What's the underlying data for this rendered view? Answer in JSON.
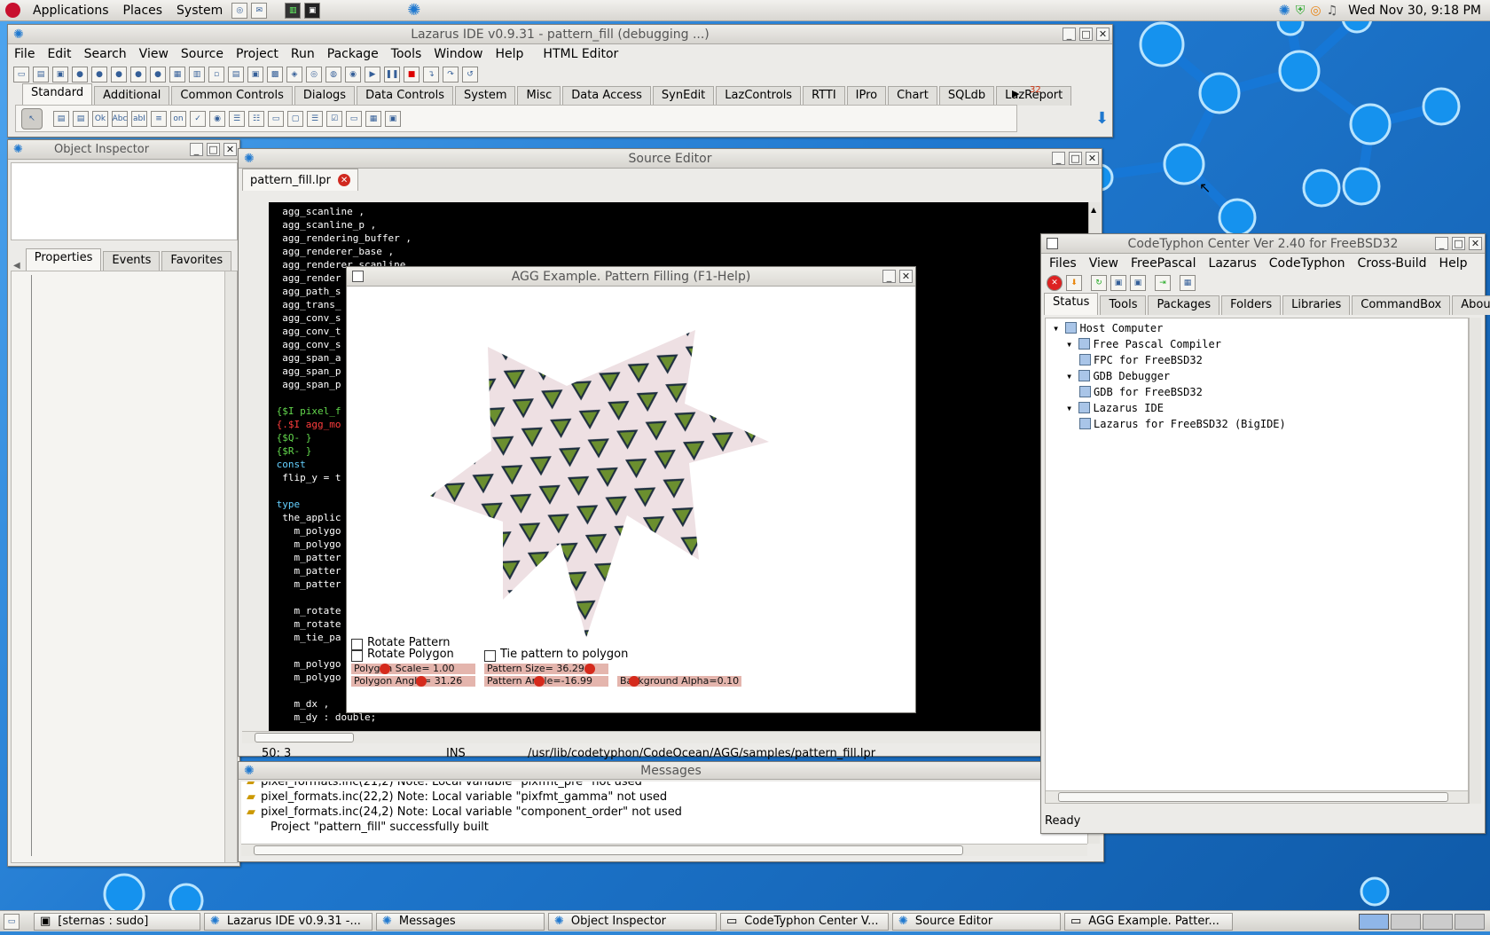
{
  "colors": {
    "accent": "#1e7ad0",
    "code_bg": "#000000",
    "code_text": "#ffffff",
    "red": "#d52a1c",
    "pattern_green": "#6b8f2f"
  },
  "panel": {
    "menu": [
      "Applications",
      "Places",
      "System"
    ],
    "clock": "Wed Nov 30,  9:18 PM"
  },
  "lazarus": {
    "title": "Lazarus IDE v0.9.31 - pattern_fill (debugging ...)",
    "menu": [
      "File",
      "Edit",
      "Search",
      "View",
      "Source",
      "Project",
      "Run",
      "Package",
      "Tools",
      "Window",
      "Help",
      "HTML Editor"
    ],
    "palette_tabs": [
      "Standard",
      "Additional",
      "Common Controls",
      "Dialogs",
      "Data Controls",
      "System",
      "Misc",
      "Data Access",
      "SynEdit",
      "LazControls",
      "RTTI",
      "IPro",
      "Chart",
      "SQLdb",
      "LazReport"
    ],
    "palette_count": "32",
    "component_icons": [
      "Ok",
      "Abc",
      "abI",
      "on",
      "✓",
      "◉"
    ]
  },
  "inspector": {
    "title": "Object Inspector",
    "tabs": [
      "Properties",
      "Events",
      "Favorites"
    ]
  },
  "editor": {
    "title": "Source Editor",
    "file": "pattern_fill.lpr",
    "lines": [
      {
        "t": "  agg_scanline ,",
        "c": ""
      },
      {
        "t": "  agg_scanline_p ,",
        "c": ""
      },
      {
        "t": "  agg_rendering_buffer ,",
        "c": ""
      },
      {
        "t": "  agg_renderer_base ,",
        "c": ""
      },
      {
        "t": "  agg_renderer_scanline",
        "c": ""
      },
      {
        "t": "  agg_render",
        "c": ""
      },
      {
        "t": "  agg_path_s",
        "c": ""
      },
      {
        "t": "  agg_trans_",
        "c": ""
      },
      {
        "t": "  agg_conv_s",
        "c": ""
      },
      {
        "t": "  agg_conv_t",
        "c": ""
      },
      {
        "t": "  agg_conv_s",
        "c": ""
      },
      {
        "t": "  agg_span_a",
        "c": ""
      },
      {
        "t": "  agg_span_p",
        "c": ""
      },
      {
        "t": "  agg_span_p",
        "c": ""
      },
      {
        "t": "",
        "c": ""
      },
      {
        "t": " {$I pixel_f",
        "c": "dir"
      },
      {
        "t": " {.$I agg_mo",
        "c": "red"
      },
      {
        "t": " {$Q- }",
        "c": "dir"
      },
      {
        "t": " {$R- }",
        "c": "dir"
      },
      {
        "t": " const",
        "c": "kw"
      },
      {
        "t": "  flip_y = t",
        "c": ""
      },
      {
        "t": "",
        "c": ""
      },
      {
        "t": " type",
        "c": "kw"
      },
      {
        "t": "  the_applic",
        "c": ""
      },
      {
        "t": "    m_polygo",
        "c": ""
      },
      {
        "t": "    m_polygo",
        "c": ""
      },
      {
        "t": "    m_patter",
        "c": ""
      },
      {
        "t": "    m_patter",
        "c": ""
      },
      {
        "t": "    m_patter",
        "c": ""
      },
      {
        "t": "",
        "c": ""
      },
      {
        "t": "    m_rotate",
        "c": ""
      },
      {
        "t": "    m_rotate",
        "c": ""
      },
      {
        "t": "    m_tie_pa",
        "c": ""
      },
      {
        "t": "",
        "c": ""
      },
      {
        "t": "    m_polygo",
        "c": ""
      },
      {
        "t": "    m_polygo",
        "c": ""
      },
      {
        "t": "",
        "c": ""
      },
      {
        "t": "    m_dx ,",
        "c": ""
      },
      {
        "t": "    m_dy : double;",
        "c": ""
      }
    ],
    "status": {
      "pos": "50:  3",
      "mode": "INS",
      "path": "/usr/lib/codetyphon/CodeOcean/AGG/samples/pattern_fill.lpr"
    }
  },
  "messages": {
    "title": "Messages",
    "items": [
      "pixel_formats.inc(21,2) Note: Local variable \"pixfmt_pre\" not used",
      "pixel_formats.inc(22,2) Note: Local variable \"pixfmt_gamma\" not used",
      "pixel_formats.inc(24,2) Note: Local variable \"component_order\" not used",
      "Project \"pattern_fill\" successfully built"
    ]
  },
  "agg": {
    "title": "AGG Example. Pattern Filling (F1-Help)",
    "checks": {
      "rotate_pattern": "Rotate Pattern",
      "rotate_polygon": "Rotate Polygon",
      "tie_pattern": "Tie pattern to polygon"
    },
    "sliders": [
      {
        "label": "Polygon Scale=  1.00",
        "value": 0.25
      },
      {
        "label": "Pattern Size= 36.29",
        "value": 0.88
      },
      {
        "label": "Polygon Angle= 31.26",
        "value": 0.57
      },
      {
        "label": "Pattern Angle=-16.99",
        "value": 0.44
      },
      {
        "label": "Background Alpha=0.10",
        "value": 0.1
      }
    ]
  },
  "codetyphon": {
    "title": "CodeTyphon Center Ver 2.40 for FreeBSD32",
    "menu": [
      "Files",
      "View",
      "FreePascal",
      "Lazarus",
      "CodeTyphon",
      "Cross-Build",
      "Help"
    ],
    "tabs": [
      "Status",
      "Tools",
      "Packages",
      "Folders",
      "Libraries",
      "CommandBox",
      "About"
    ],
    "tree": [
      {
        "text": "Host Computer",
        "level": 0,
        "icon": "computer-icon"
      },
      {
        "text": "Free Pascal Compiler",
        "level": 1,
        "icon": "compiler-icon"
      },
      {
        "text": "FPC for FreeBSD32",
        "level": 2,
        "icon": "gear-icon"
      },
      {
        "text": "GDB Debugger",
        "level": 1,
        "icon": "debugger-icon"
      },
      {
        "text": "GDB for FreeBSD32",
        "level": 2,
        "icon": "gear-icon"
      },
      {
        "text": "Lazarus IDE",
        "level": 1,
        "icon": "lazarus-icon"
      },
      {
        "text": "Lazarus for FreeBSD32 (BigIDE)",
        "level": 2,
        "icon": "lazarus-32-icon"
      }
    ],
    "status": "Ready"
  },
  "taskbar": [
    "[sternas : sudo]",
    "Lazarus IDE v0.9.31 -...",
    "Messages",
    "Object Inspector",
    "CodeTyphon Center V...",
    "Source Editor",
    "AGG Example. Patter..."
  ]
}
